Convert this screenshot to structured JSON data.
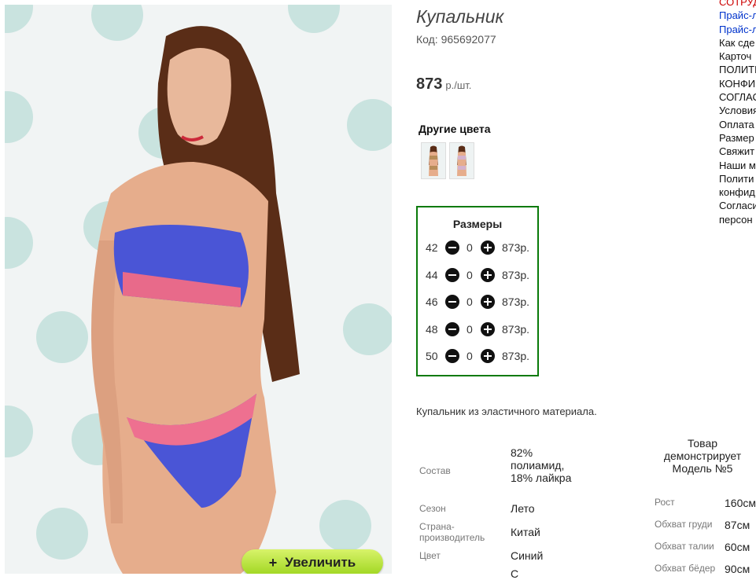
{
  "product": {
    "title": "Купальник",
    "code": "Код: 965692077",
    "price": "873",
    "price_unit": "р./шт.",
    "other_colors_title": "Другие цвета",
    "zoom_label": "Увеличить",
    "description": "Купальник из эластичного материала."
  },
  "sizes": {
    "title": "Размеры",
    "rows": [
      {
        "size": "42",
        "qty": "0",
        "price": "873р."
      },
      {
        "size": "44",
        "qty": "0",
        "price": "873р."
      },
      {
        "size": "46",
        "qty": "0",
        "price": "873р."
      },
      {
        "size": "48",
        "qty": "0",
        "price": "873р."
      },
      {
        "size": "50",
        "qty": "0",
        "price": "873р."
      }
    ]
  },
  "properties": [
    {
      "label": "Состав",
      "value": "82% полиамид, 18% лайкра"
    },
    {
      "label": "Сезон",
      "value": "Лето"
    },
    {
      "label": "Страна-производитель",
      "value": "Китай"
    },
    {
      "label": "Цвет",
      "value": "Синий"
    },
    {
      "label": "",
      "value": "С"
    }
  ],
  "model": {
    "title": "Товар демонстрирует Модель №5",
    "measurements": [
      {
        "label": "Рост",
        "value": "160см"
      },
      {
        "label": "Обхват груди",
        "value": "87см"
      },
      {
        "label": "Обхват талии",
        "value": "60см"
      },
      {
        "label": "Обхват бёдер",
        "value": "90см"
      }
    ]
  },
  "right_nav": [
    {
      "label": "СОТРУД",
      "style": "red"
    },
    {
      "label": "Прайс-л",
      "style": "blue"
    },
    {
      "label": "Прайс-л",
      "style": "blue"
    },
    {
      "label": "Как сде",
      "style": "plain"
    },
    {
      "label": "Карточ",
      "style": "plain"
    },
    {
      "label": "ПОЛИТИ",
      "style": "plain"
    },
    {
      "label": "КОНФИ",
      "style": "plain"
    },
    {
      "label": "СОГЛАС",
      "style": "plain"
    },
    {
      "label": "Условия",
      "style": "plain"
    },
    {
      "label": "Оплата",
      "style": "plain"
    },
    {
      "label": "Размер",
      "style": "plain"
    },
    {
      "label": "Свяжит",
      "style": "plain"
    },
    {
      "label": "Наши м",
      "style": "plain"
    },
    {
      "label": "Полити",
      "style": "plain"
    },
    {
      "label": "конфид",
      "style": "plain"
    },
    {
      "label": "Согласи",
      "style": "plain"
    },
    {
      "label": "персон",
      "style": "plain"
    }
  ],
  "colors": {
    "accent_green": "#0a7a0a",
    "zoom_button": "#b6e33a",
    "link_blue": "#0033cc",
    "link_red": "#cc0000"
  }
}
